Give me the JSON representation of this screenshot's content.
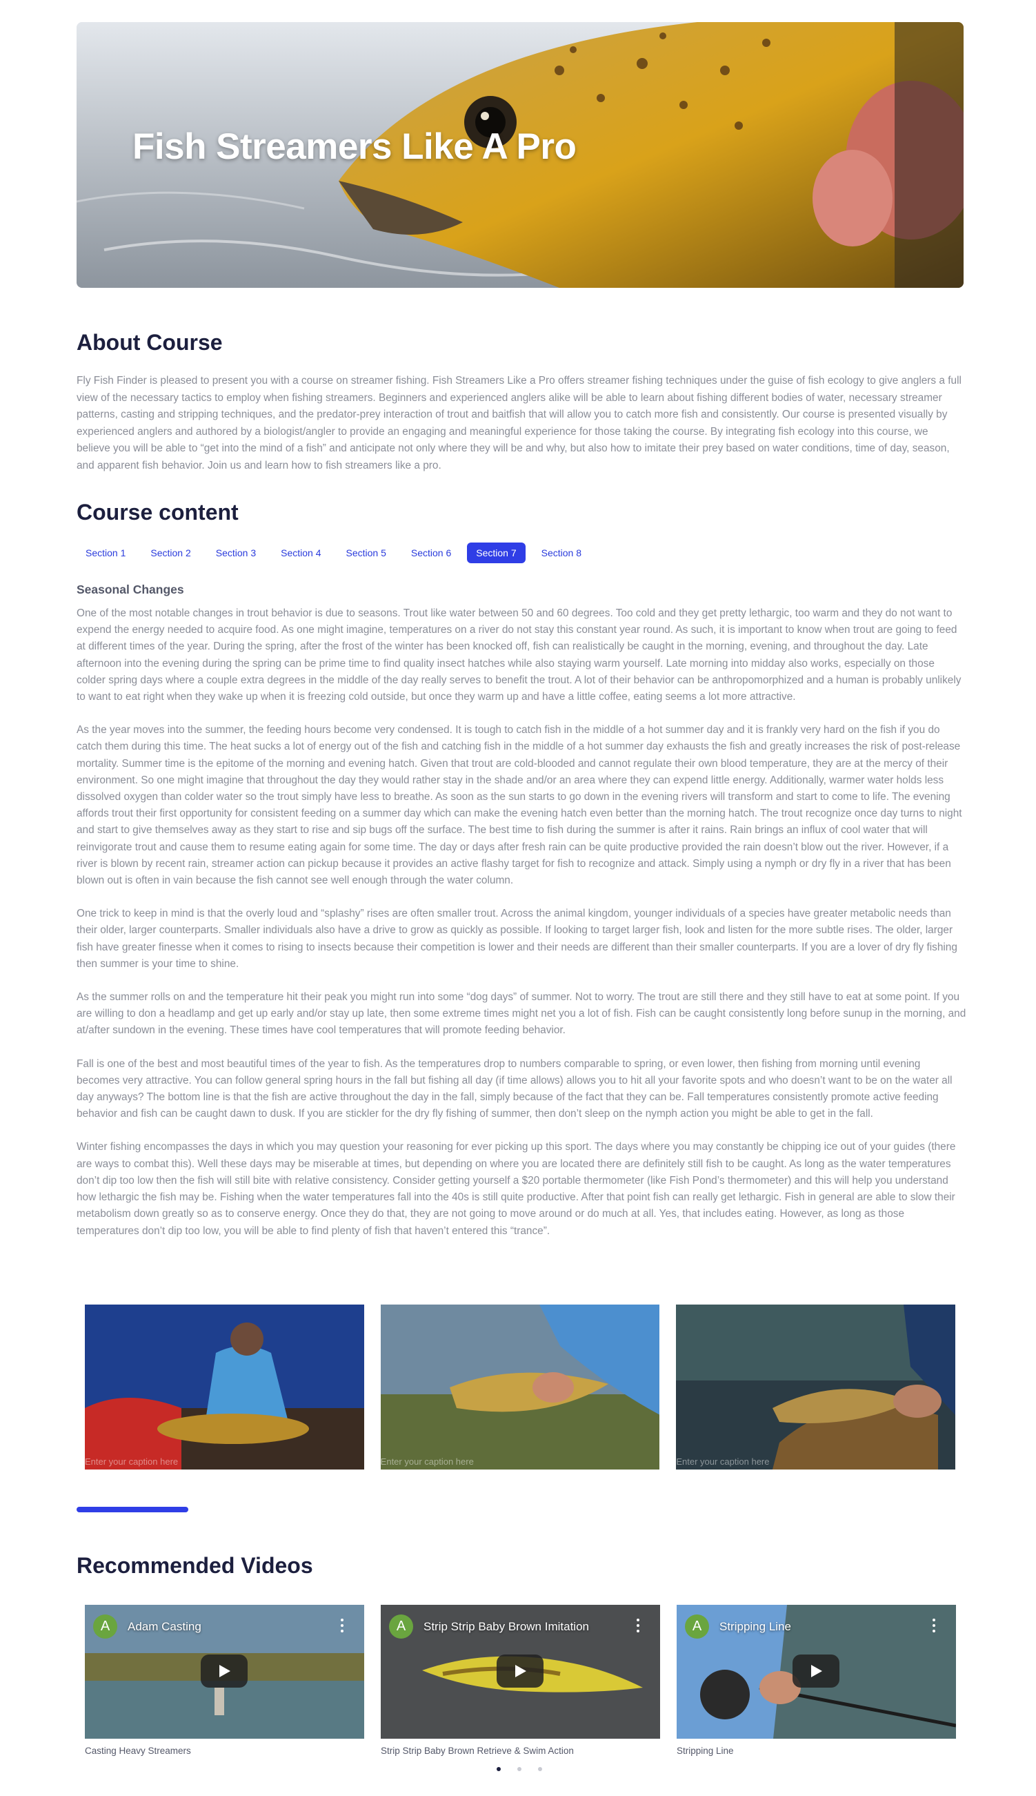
{
  "hero": {
    "title": "Fish Streamers Like A Pro"
  },
  "about": {
    "heading": "About Course",
    "text": "Fly Fish Finder is pleased to present you with a course on streamer fishing. Fish Streamers Like a Pro offers streamer fishing techniques under the guise of fish ecology to give anglers a full view of the necessary tactics to employ when fishing streamers. Beginners and experienced anglers alike will be able to learn about fishing different bodies of water, necessary streamer patterns, casting and stripping techniques, and the predator-prey interaction of trout and baitfish that will allow you to catch more fish and consistently. Our course is presented visually by experienced anglers and authored by a biologist/angler to provide an engaging and meaningful experience for those taking the course. By integrating fish ecology into this course, we believe you will be able to “get into the mind of a fish” and anticipate not only where they will be and why, but also how to imitate their prey based on water conditions, time of day, season, and apparent fish behavior. Join us and learn how to fish streamers like a pro."
  },
  "course": {
    "heading": "Course content",
    "tabs": [
      "Section 1",
      "Section 2",
      "Section 3",
      "Section 4",
      "Section 5",
      "Section 6",
      "Section 7",
      "Section 8"
    ],
    "active_tab": "Section 7",
    "section_title": "Seasonal Changes",
    "paragraphs": [
      "One of the most notable changes in trout behavior is due to seasons. Trout like water between 50 and 60 degrees. Too cold and they get pretty lethargic, too warm and they do not want to expend the energy needed to acquire food. As one might imagine, temperatures on a river do not stay this constant year round. As such, it is important to know when trout are going to feed at different times of the year. During the spring, after the frost of the winter has been knocked off, fish can realistically be caught in the morning, evening, and throughout the day. Late afternoon into the evening during the spring can be prime time to find quality insect hatches while also staying warm yourself. Late morning into midday also works, especially on those colder spring days where a couple extra degrees in the middle of the day really serves to benefit the trout. A lot of their behavior can be anthropomorphized and a human is probably unlikely to want to eat right when they wake up when it is freezing cold outside, but once they warm up and have a little coffee, eating seems a lot more attractive.",
      "As the year moves into the summer, the feeding hours become very condensed. It is tough to catch fish in the middle of a hot summer day and it is frankly very hard on the fish if you do catch them during this time. The heat sucks a lot of energy out of the fish and catching fish in the middle of a hot summer day exhausts the fish and greatly increases the risk of post-release mortality. Summer time is the epitome of the morning and evening hatch. Given that trout are cold-blooded and cannot regulate their own blood temperature, they are at the mercy of their environment. So one might imagine that throughout the day they would rather stay in the shade and/or an area where they can expend little energy. Additionally, warmer water holds less dissolved oxygen than colder water so the trout simply have less to breathe. As soon as the sun starts to go down in the evening rivers will transform and start to come to life. The evening affords trout their first opportunity for consistent feeding on a summer day which can make the evening hatch even better than the morning hatch. The trout recognize once day turns to night and start to give themselves away as they start to rise and sip bugs off the surface. The best time to fish during the summer is after it rains. Rain brings an influx of cool water that will reinvigorate trout and cause them to resume eating again for some time. The day or days after fresh rain can be quite productive provided the rain doesn’t blow out the river. However, if a river is blown by recent rain, streamer action can pickup because it provides an active flashy target for fish to recognize and attack. Simply using a nymph or dry fly in a river that has been blown out is often in vain because the fish cannot see well enough through the water column.",
      "One trick to keep in mind is that the overly loud and “splashy” rises are often smaller trout. Across the animal kingdom, younger individuals of a species have greater metabolic needs than their older, larger counterparts. Smaller individuals also have a drive to grow as quickly as possible. If looking to target larger fish, look and listen for the more subtle rises. The older, larger fish have greater finesse when it comes to rising to insects because their competition is lower and their needs are different than their smaller counterparts. If you are a lover of dry fly fishing then summer is your time to shine.",
      "As the summer rolls on and the temperature hit their peak you might run into some “dog days” of summer. Not to worry. The trout are still there and they still have to eat at some point. If you are willing to don a headlamp and get up early and/or stay up late, then some extreme times might net you a lot of fish. Fish can be caught consistently long before sunup in the morning, and at/after sundown in the evening. These times have cool temperatures that will promote feeding behavior.",
      "Fall is one of the best and most beautiful times of the year to fish. As the temperatures drop to numbers comparable to spring, or even lower, then fishing from morning until evening becomes very attractive. You can follow general spring hours in the fall but fishing all day (if time allows) allows you to hit all your favorite spots and who doesn’t want to be on the water all day anyways? The bottom line is that the fish are active throughout the day in the fall, simply because of the fact that they can be. Fall temperatures consistently promote active feeding behavior and fish can be caught dawn to dusk. If you are stickler for the dry fly fishing of summer, then don’t sleep on the nymph action you might be able to get in the fall.",
      "Winter fishing encompasses the days in which you may question your reasoning for ever picking up this sport. The days where you may constantly be chipping ice out of your guides (there are ways to combat this). Well these days may be miserable at times, but depending on where you are located there are definitely still fish to be caught. As long as the water temperatures don’t dip too low then the fish will still bite with relative consistency. Consider getting yourself a $20 portable thermometer (like Fish Pond’s thermometer) and this will help you understand how lethargic the fish may be. Fishing when the water temperatures fall into the 40s is still quite productive. After that point fish can really get lethargic. Fish in general are able to slow their metabolism down greatly so as to conserve energy. Once they do that, they are not going to move around or do much at all. Yes, that includes eating. However, as long as those temperatures don’t dip too low, you will be able to find plenty of fish that haven’t entered this “trance”."
    ]
  },
  "gallery": {
    "captions": [
      "Enter your caption here",
      "Enter your caption here",
      "Enter your caption here"
    ]
  },
  "recommended": {
    "heading": "Recommended Videos",
    "videos": [
      {
        "avatar": "A",
        "title": "Adam Casting",
        "caption": "Casting Heavy Streamers"
      },
      {
        "avatar": "A",
        "title": "Strip Strip Baby Brown Imitation",
        "caption": "Strip Strip Baby Brown Retrieve & Swim Action"
      },
      {
        "avatar": "A",
        "title": "Stripping Line",
        "caption": "Stripping Line"
      }
    ],
    "carousel_pages": 3,
    "carousel_active": 1
  },
  "colors": {
    "accent": "#2f3ee6",
    "heading": "#1c1f3e",
    "body_text": "#8a8d97",
    "avatar": "#6aa53f"
  }
}
